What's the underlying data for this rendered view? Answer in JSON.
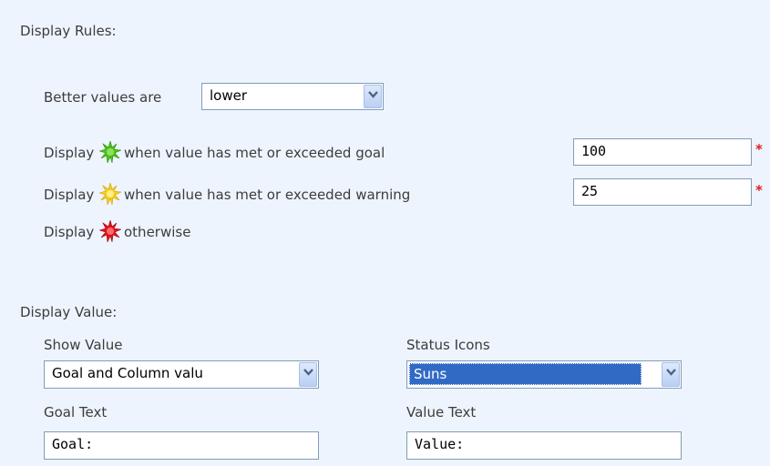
{
  "display_rules": {
    "heading": "Display Rules:",
    "better_values_label": "Better values are",
    "better_values_selected": "lower",
    "rules": [
      {
        "prefix": "Display",
        "icon": "green-star-icon",
        "text": "when value has met or exceeded goal",
        "value": "100",
        "required": "*"
      },
      {
        "prefix": "Display",
        "icon": "yellow-star-icon",
        "text": "when value has met or exceeded warning",
        "value": "25",
        "required": "*"
      },
      {
        "prefix": "Display",
        "icon": "red-star-icon",
        "text": "otherwise"
      }
    ]
  },
  "display_value": {
    "heading": "Display Value:",
    "show_value_label": "Show Value",
    "show_value_selected": "Goal and Column valu",
    "status_icons_label": "Status Icons",
    "status_icons_selected": "Suns",
    "goal_text_label": "Goal Text",
    "goal_text_value": "Goal:",
    "value_text_label": "Value Text",
    "value_text_value": "Value:"
  },
  "colors": {
    "panel_bg": "#eef4fd",
    "field_border": "#7f9db9",
    "selection_bg": "#316ac5",
    "required_mark": "#e02020",
    "green_star": "#4cc21a",
    "yellow_star": "#f5d21a",
    "red_star": "#e0141e"
  }
}
